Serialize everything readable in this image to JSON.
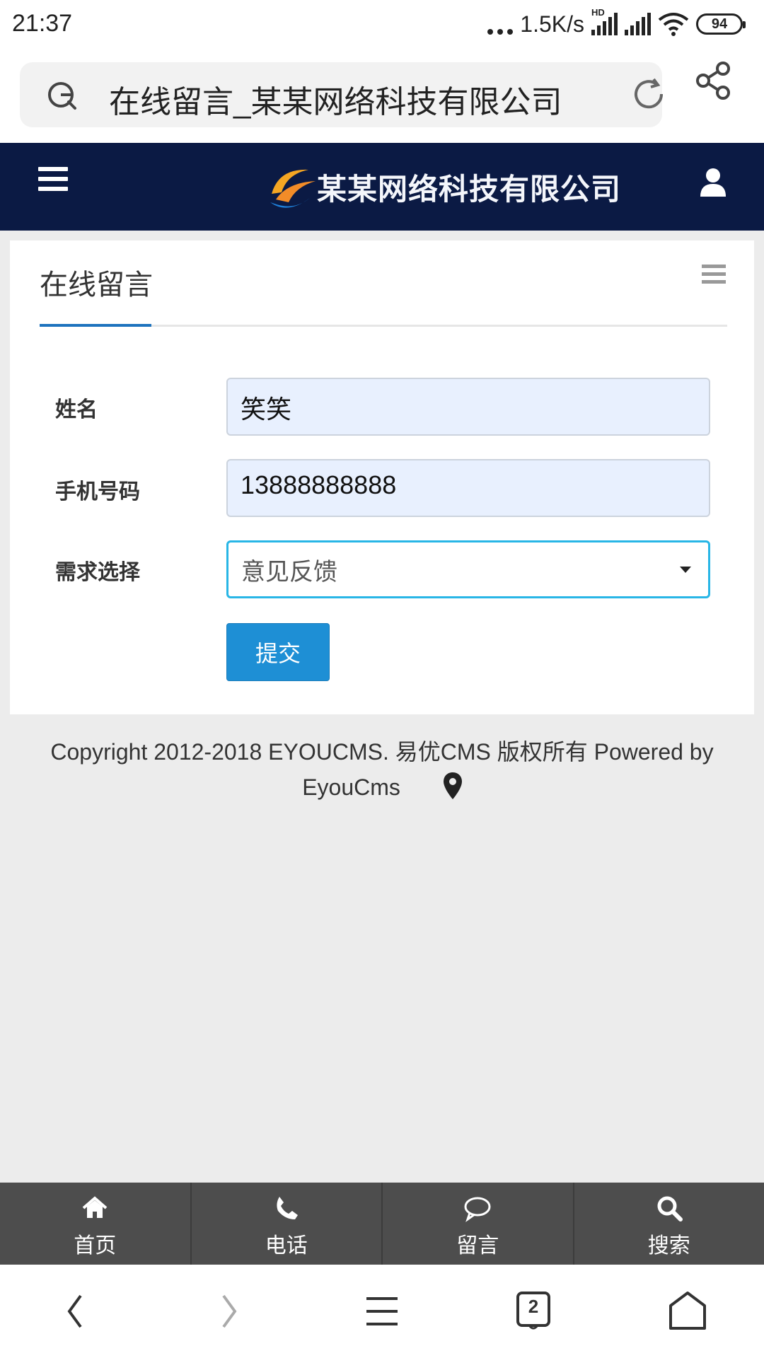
{
  "status_bar": {
    "time": "21:37",
    "net_speed": "1.5K/s",
    "hd_label": "HD",
    "battery": "94"
  },
  "browser": {
    "page_title": "在线留言_某某网络科技有限公司"
  },
  "header": {
    "logo_text": "某某网络科技有限公司"
  },
  "panel": {
    "title": "在线留言"
  },
  "form": {
    "name_label": "姓名",
    "name_value": "笑笑",
    "phone_label": "手机号码",
    "phone_value": "13888888888",
    "need_label": "需求选择",
    "need_selected": "意见反馈",
    "submit_label": "提交"
  },
  "footer": {
    "copyright_line1": "Copyright 2012-2018 EYOUCMS. 易优CMS 版权所有 Powered by",
    "copyright_line2": "EyouCms"
  },
  "bottom_nav": {
    "items": [
      {
        "label": "首页",
        "icon": "home-icon"
      },
      {
        "label": "电话",
        "icon": "phone-icon"
      },
      {
        "label": "留言",
        "icon": "message-icon"
      },
      {
        "label": "搜索",
        "icon": "search-icon"
      }
    ]
  },
  "system_nav": {
    "tab_count": "2"
  },
  "colors": {
    "header_bg": "#0b1a44",
    "accent": "#1e8fd5",
    "focus_border": "#28b6e6",
    "nav_bg": "#4d4d4d"
  }
}
